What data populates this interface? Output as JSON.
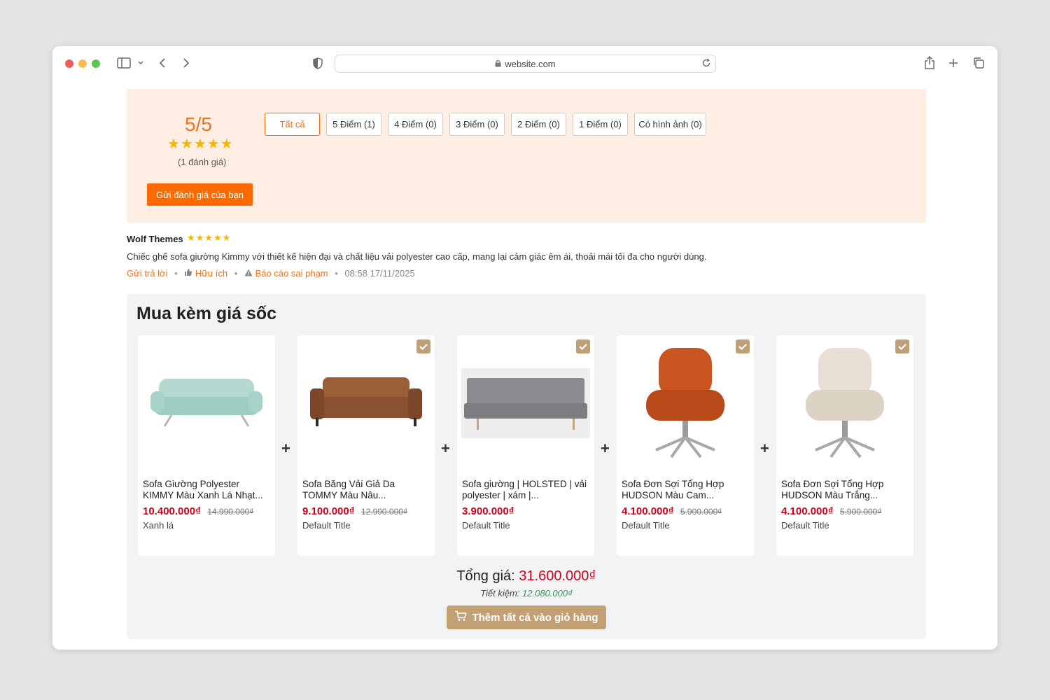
{
  "browser": {
    "url": "website.com"
  },
  "rating": {
    "score": "5/5",
    "stars": "★★★★★",
    "count": "(1 đánh giá)",
    "send_label": "Gửi đánh giá của bạn",
    "filters": [
      "Tất cả",
      "5 Điểm (1)",
      "4 Điểm (0)",
      "3 Điểm (0)",
      "2 Điểm (0)",
      "1 Điểm (0)",
      "Có hình ảnh (0)"
    ]
  },
  "review": {
    "author": "Wolf Themes",
    "stars": "★★★★★",
    "text": "Chiếc ghế sofa giường Kimmy với thiết kế hiện đại và chất liệu vải polyester cao cấp, mang lại cảm giác êm ái, thoải mái tối đa cho người dùng.",
    "reply_label": "Gửi trả lời",
    "helpful_label": "Hữu ích",
    "report_label": "Báo cáo sai phạm",
    "time": "08:58 17/11/2025"
  },
  "bundle": {
    "title": "Mua kèm giá sốc",
    "products": [
      {
        "name": "Sofa Giường Polyester KIMMY Màu Xanh Lá Nhạt...",
        "price": "10.400.000₫",
        "old_price": "14.990.000₫",
        "variant": "Xanh lá",
        "color": "#a9d1c9"
      },
      {
        "name": "Sofa Băng Vải Giả Da TOMMY Màu Nâu...",
        "price": "9.100.000₫",
        "old_price": "12.990.000₫",
        "variant": "Default Title",
        "color": "#8a5230"
      },
      {
        "name": "Sofa giường | HOLSTED | vải polyester | xám |...",
        "price": "3.900.000₫",
        "old_price": "",
        "variant": "Default Title",
        "color": "#7c7d80"
      },
      {
        "name": "Sofa Đơn Sợi Tổng Hợp HUDSON Màu Cam...",
        "price": "4.100.000₫",
        "old_price": "5.900.000₫",
        "variant": "Default Title",
        "color": "#c9541f"
      },
      {
        "name": "Sofa Đơn Sợi Tổng Hợp HUDSON Màu Trắng...",
        "price": "4.100.000₫",
        "old_price": "5.900.000₫",
        "variant": "Default Title",
        "color": "#e5ddd2"
      }
    ],
    "total_label": "Tổng giá:",
    "total_value": "31.600.000₫",
    "saving_label": "Tiết kiệm:",
    "saving_value": "12.080.000₫",
    "add_all_label": "Thêm tất cả vào giỏ hàng"
  },
  "colors": {
    "accent": "#ff6a00",
    "price": "#d0021b",
    "gold": "#c39f74",
    "panel": "#ffeee3"
  }
}
